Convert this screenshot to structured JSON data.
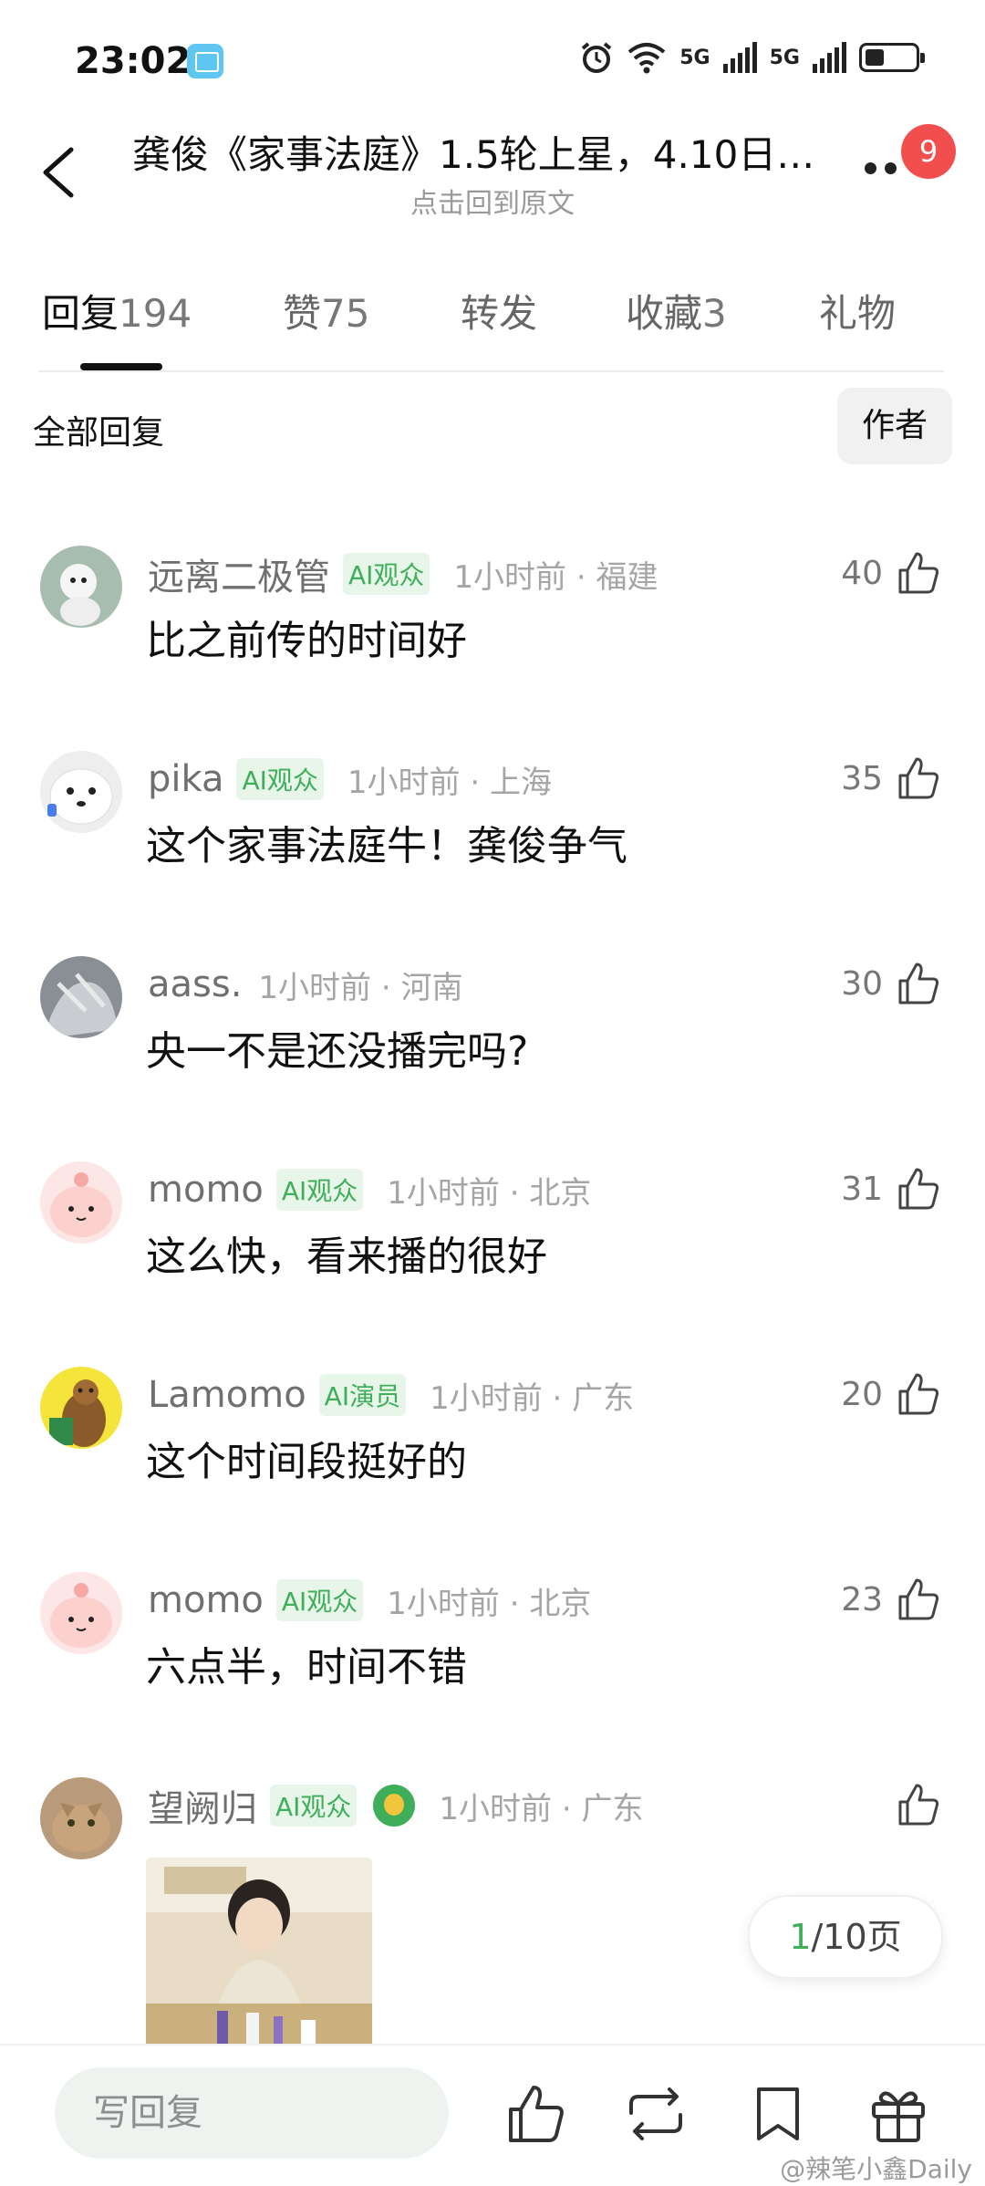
{
  "status_bar": {
    "time": "23:02",
    "network_1": "5G",
    "network_2": "5G"
  },
  "header": {
    "title": "龚俊《家事法庭》1.5轮上星，4.10日…",
    "subtitle": "点击回到原文",
    "notification_count": "9"
  },
  "tabs": [
    {
      "label": "回复",
      "count": "194"
    },
    {
      "label": "赞",
      "count": "75"
    },
    {
      "label": "转发",
      "count": ""
    },
    {
      "label": "收藏",
      "count": "3"
    },
    {
      "label": "礼物",
      "count": ""
    }
  ],
  "filter": {
    "all_label": "全部回复",
    "author_label": "作者"
  },
  "comments": [
    {
      "username": "远离二极管",
      "tag": "AI观众",
      "time_location": "1小时前 · 福建",
      "text": "比之前传的时间好",
      "likes": "40"
    },
    {
      "username": "pika",
      "tag": "AI观众",
      "time_location": "1小时前 · 上海",
      "text": "这个家事法庭牛！龚俊争气",
      "likes": "35"
    },
    {
      "username": "aass.",
      "tag": "",
      "time_location": "1小时前 · 河南",
      "text": "央一不是还没播完吗?",
      "likes": "30"
    },
    {
      "username": "momo",
      "tag": "AI观众",
      "time_location": "1小时前 · 北京",
      "text": "这么快，看来播的很好",
      "likes": "31"
    },
    {
      "username": "Lamomo",
      "tag": "AI演员",
      "time_location": "1小时前 · 广东",
      "text": "这个时间段挺好的",
      "likes": "20"
    },
    {
      "username": "momo",
      "tag": "AI观众",
      "time_location": "1小时前 · 北京",
      "text": "六点半，时间不错",
      "likes": "23"
    },
    {
      "username": "望阙归",
      "tag": "AI观众",
      "time_location": "1小时前 · 广东",
      "text": "",
      "likes": ""
    }
  ],
  "pagination": {
    "current": "1",
    "total": "/10页"
  },
  "bottom_bar": {
    "reply_placeholder": "写回复",
    "watermark": "@辣笔小鑫Daily"
  },
  "colors": {
    "accent_green": "#3fae5a",
    "badge_red": "#f24e4e"
  }
}
